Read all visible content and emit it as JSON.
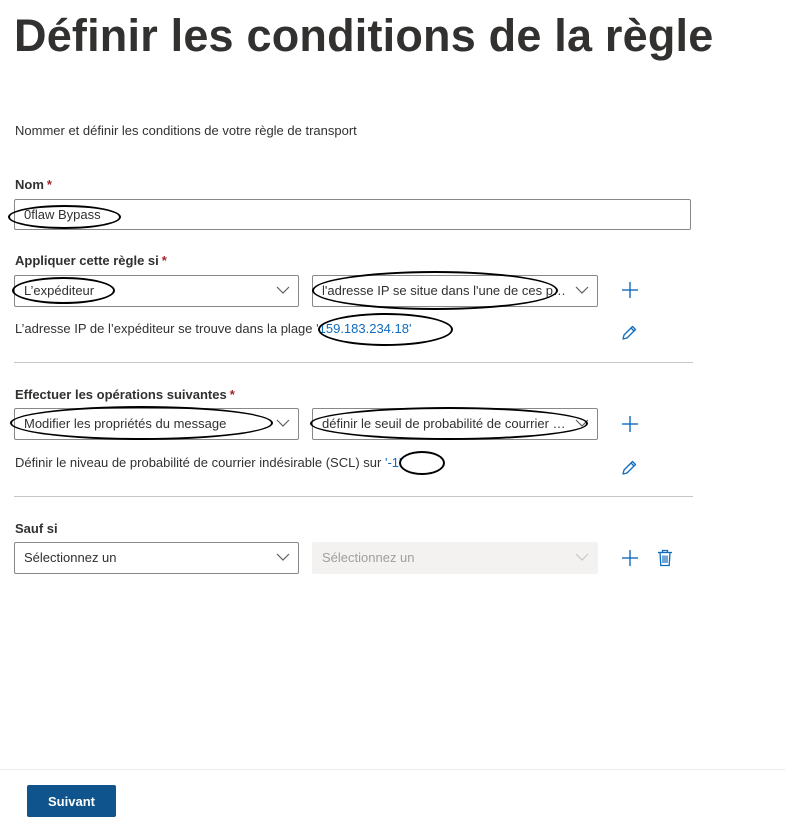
{
  "header": {
    "title": "Définir les conditions de la règle",
    "subtitle": "Nommer et définir les conditions de votre règle de transport"
  },
  "name_field": {
    "label": "Nom",
    "required_mark": "*",
    "value": "0flaw Bypass"
  },
  "apply_if": {
    "label": "Appliquer cette règle si",
    "required_mark": "*",
    "condition": "L’expéditeur",
    "sub_condition": "l'adresse IP se situe dans l'une de ces plages ou correspond exactement à",
    "summary_text": "L’adresse IP de l’expéditeur se trouve dans la plage",
    "summary_value": "'159.183.234.18'",
    "add_icon": "plus-icon",
    "edit_icon": "pencil-icon"
  },
  "actions": {
    "label": "Effectuer les opérations suivantes",
    "required_mark": "*",
    "action": "Modifier les propriétés du message",
    "sub_action": "définir le seuil de probabilité de courrier indésirable (SCL)",
    "summary_text": "Définir le niveau de probabilité de courrier indésirable (SCL) sur",
    "summary_value": "'-1'",
    "add_icon": "plus-icon",
    "edit_icon": "pencil-icon"
  },
  "except_if": {
    "label": "Sauf si",
    "condition": "Sélectionnez un",
    "sub_condition": "Sélectionnez un",
    "add_icon": "plus-icon",
    "delete_icon": "trash-icon"
  },
  "footer": {
    "next_label": "Suivant"
  },
  "colors": {
    "primary": "#0f548c",
    "link": "#0f6cbd",
    "required": "#a4262c",
    "text": "#323130"
  }
}
